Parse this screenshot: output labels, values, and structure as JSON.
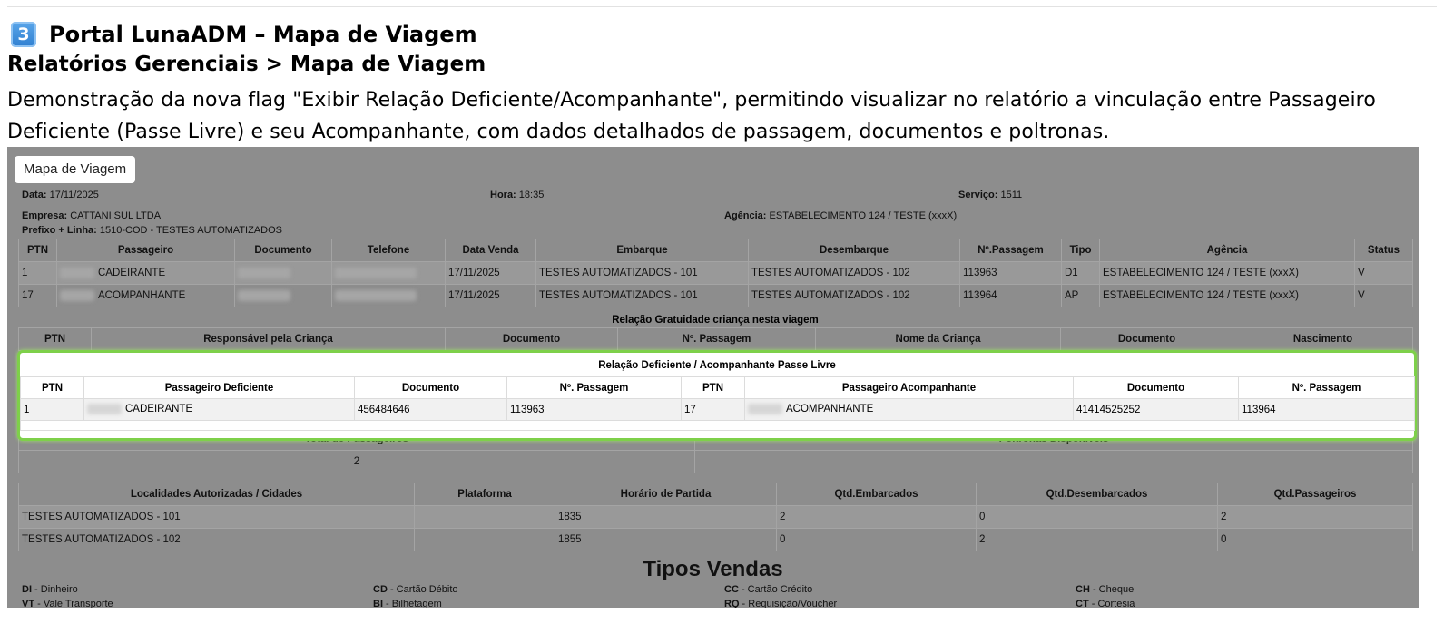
{
  "header": {
    "step_badge": "3",
    "title": "Portal LunaADM – Mapa de Viagem",
    "breadcrumb": "Relatórios Gerenciais > Mapa de Viagem",
    "description": "Demonstração da nova flag \"Exibir Relação Deficiente/Acompanhante\", permitindo visualizar no relatório a vinculação entre Passageiro Deficiente (Passe Livre) e seu Acompanhante, com dados detalhados de passagem, documentos e poltronas."
  },
  "screenshot": {
    "tab_label": "Mapa de Viagem",
    "info": {
      "data_label": "Data:",
      "data_value": "17/11/2025",
      "hora_label": "Hora:",
      "hora_value": "18:35",
      "servico_label": "Serviço:",
      "servico_value": "1511",
      "empresa_label": "Empresa:",
      "empresa_value": "CATTANI SUL LTDA",
      "agencia_label": "Agência:",
      "agencia_value": "ESTABELECIMENTO 124 / TESTE (xxxX)",
      "prefixo_label": "Prefixo + Linha:",
      "prefixo_value": "1510-COD - TESTES AUTOMATIZADOS"
    },
    "passengers": {
      "headers": [
        "PTN",
        "Passageiro",
        "Documento",
        "Telefone",
        "Data Venda",
        "Embarque",
        "Desembarque",
        "Nº.Passagem",
        "Tipo",
        "Agência",
        "Status"
      ],
      "rows": [
        {
          "ptn": "1",
          "passageiro": "CADEIRANTE",
          "data_venda": "17/11/2025",
          "embarque": "TESTES AUTOMATIZADOS - 101",
          "desembarque": "TESTES AUTOMATIZADOS - 102",
          "passagem": "113963",
          "tipo": "D1",
          "agencia": "ESTABELECIMENTO 124 / TESTE (xxxX)",
          "status": "V"
        },
        {
          "ptn": "17",
          "passageiro": "ACOMPANHANTE",
          "data_venda": "17/11/2025",
          "embarque": "TESTES AUTOMATIZADOS - 101",
          "desembarque": "TESTES AUTOMATIZADOS - 102",
          "passagem": "113964",
          "tipo": "AP",
          "agencia": "ESTABELECIMENTO 124 / TESTE (xxxX)",
          "status": "V"
        }
      ]
    },
    "gratuidade": {
      "title": "Relação Gratuidade criança nesta viagem",
      "headers": [
        "PTN",
        "Responsável pela Criança",
        "Documento",
        "Nº. Passagem",
        "Nome da Criança",
        "Documento",
        "Nascimento"
      ]
    },
    "deficiente": {
      "title": "Relação Deficiente / Acompanhante Passe Livre",
      "headers": [
        "PTN",
        "Passageiro Deficiente",
        "Documento",
        "Nº. Passagem",
        "PTN",
        "Passageiro Acompanhante",
        "Documento",
        "Nº. Passagem"
      ],
      "row": {
        "ptn1": "1",
        "deficiente": "CADEIRANTE",
        "doc1": "456484646",
        "passagem1": "113963",
        "ptn2": "17",
        "acompanhante": "ACOMPANHANTE",
        "doc2": "41414525252",
        "passagem2": "113964"
      }
    },
    "totals": {
      "total_label": "Total de Passageiros",
      "total_value": "2",
      "poltronas_label": "Poltronas Disponíveis"
    },
    "localidades": {
      "headers": [
        "Localidades Autorizadas / Cidades",
        "Plataforma",
        "Horário de Partida",
        "Qtd.Embarcados",
        "Qtd.Desembarcados",
        "Qtd.Passageiros"
      ],
      "rows": [
        {
          "cidade": "TESTES AUTOMATIZADOS - 101",
          "plataforma": "",
          "horario": "1835",
          "embarcados": "2",
          "desembarcados": "0",
          "passageiros": "2"
        },
        {
          "cidade": "TESTES AUTOMATIZADOS - 102",
          "plataforma": "",
          "horario": "1855",
          "embarcados": "0",
          "desembarcados": "2",
          "passageiros": "0"
        }
      ]
    },
    "tipos_vendas": {
      "title": "Tipos Vendas",
      "items": [
        {
          "code": "DI",
          "label": " - Dinheiro"
        },
        {
          "code": "CD",
          "label": " - Cartão Débito"
        },
        {
          "code": "CC",
          "label": " - Cartão Crédito"
        },
        {
          "code": "CH",
          "label": " - Cheque"
        },
        {
          "code": "VT",
          "label": " - Vale Transporte"
        },
        {
          "code": "BI",
          "label": " - Bilhetagem"
        },
        {
          "code": "RQ",
          "label": " - Requisição/Voucher"
        },
        {
          "code": "CT",
          "label": " - Cortesia"
        }
      ]
    }
  },
  "colors": {
    "highlight_border": "#7ed04a",
    "overlay_gray": "#8d8d8d",
    "badge_blue": "#2f7fd0"
  }
}
